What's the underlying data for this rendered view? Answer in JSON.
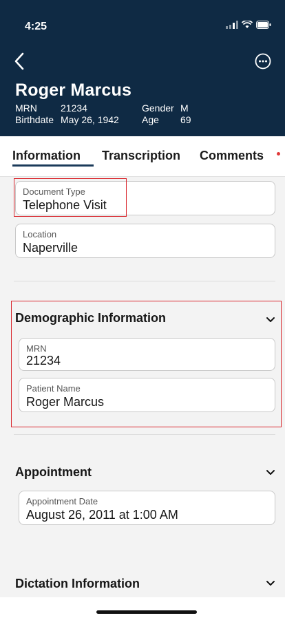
{
  "status_bar": {
    "time": "4:25"
  },
  "header": {
    "patient_name": "Roger Marcus",
    "mrn_label": "MRN",
    "mrn_value": "21234",
    "gender_label": "Gender",
    "gender_value": "M",
    "birthdate_label": "Birthdate",
    "birthdate_value": "May 26, 1942",
    "age_label": "Age",
    "age_value": "69"
  },
  "tabs": [
    {
      "label": "Information",
      "active": true
    },
    {
      "label": "Transcription",
      "active": false
    },
    {
      "label": "Comments",
      "active": false,
      "has_notification": true
    }
  ],
  "fields": {
    "document_type": {
      "label": "Document Type",
      "value": "Telephone Visit"
    },
    "location": {
      "label": "Location",
      "value": "Naperville"
    },
    "mrn": {
      "label": "MRN",
      "value": "21234"
    },
    "patient_name": {
      "label": "Patient Name",
      "value": "Roger Marcus"
    },
    "appointment_date": {
      "label": "Appointment Date",
      "value": "August 26, 2011 at 1:00 AM"
    }
  },
  "sections": {
    "demographic": "Demographic Information",
    "appointment": "Appointment",
    "dictation": "Dictation Information"
  },
  "colors": {
    "header_bg": "#0f2a44",
    "highlight": "#d9252b",
    "notification_dot": "#e03a3a"
  },
  "icons": {
    "back": "chevron-left-icon",
    "more": "more-horizontal-circle-icon",
    "expand": "chevron-down-icon"
  }
}
